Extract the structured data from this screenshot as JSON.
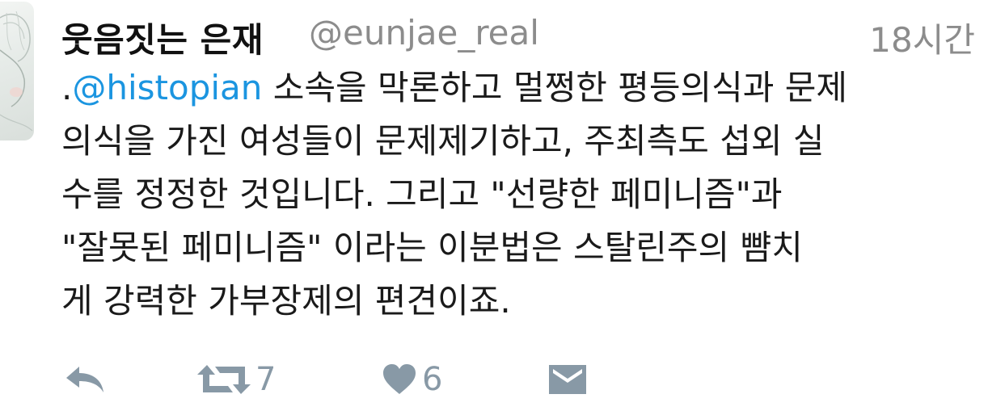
{
  "tweet": {
    "display_name": "웃음짓는 은재",
    "handle": "@eunjae_real",
    "time": "18시간",
    "body": {
      "line1_prefix": ".",
      "mention": "@histopian",
      "line1_rest": " 소속을 막론하고 멀쩡한 평등의식과 문제",
      "line2": "의식을 가진 여성들이 문제제기하고, 주최측도 섭외 실",
      "line3": "수를 정정한 것입니다. 그리고 \"선량한 페미니즘\"과",
      "line4": "\"잘못된 페미니즘\" 이라는 이분법은 스탈린주의 뺨치",
      "line5": "게 강력한 가부장제의 편견이죠."
    },
    "actions": {
      "reply_icon": "reply-icon",
      "retweet_icon": "retweet-icon",
      "retweet_count": "7",
      "like_icon": "heart-icon",
      "like_count": "6",
      "message_icon": "envelope-icon"
    }
  },
  "colors": {
    "mention": "#1b95e0",
    "muted": "#8c8c8c",
    "action": "#8899a6"
  }
}
